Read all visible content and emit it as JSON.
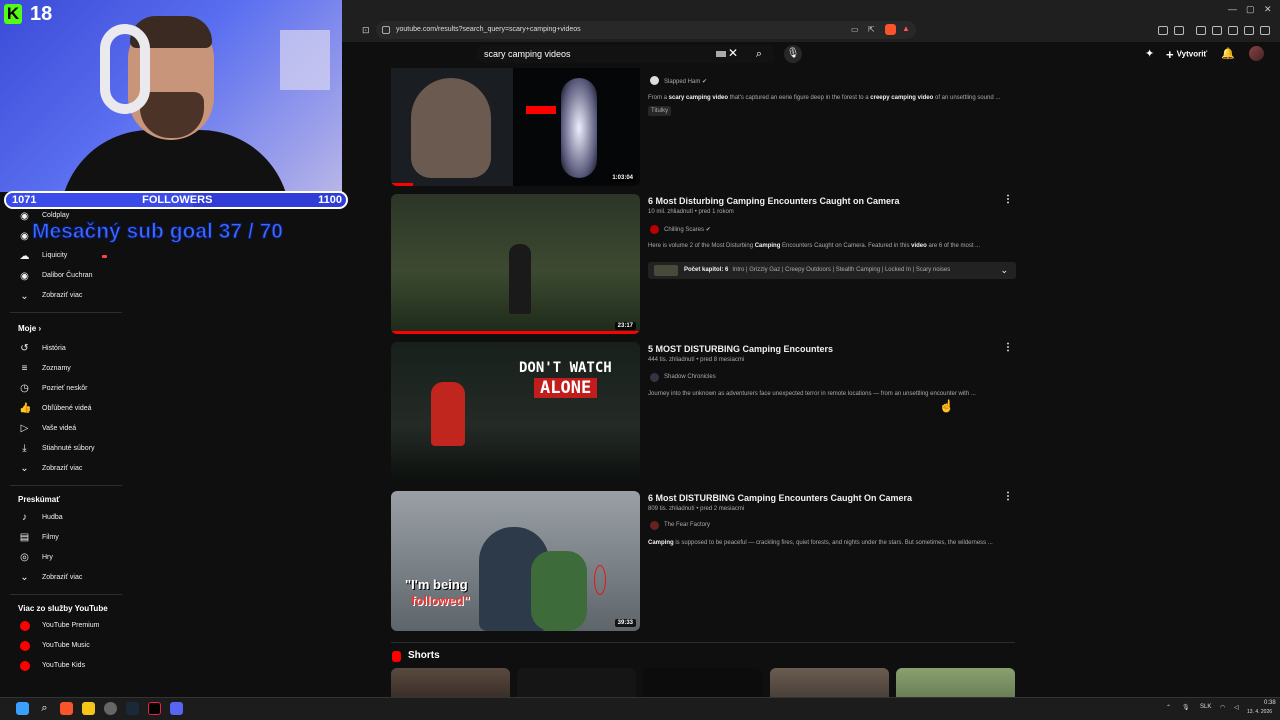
{
  "stream_overlay": {
    "kick_badge": "K",
    "viewer_count": "18",
    "followers_current": "1071",
    "followers_label": "FOLLOWERS",
    "followers_goal": "1100",
    "followers_progress_fraction": 0.55,
    "sub_goal_text": "Mesačný sub goal 37 / 70"
  },
  "browser": {
    "url": "youtube.com/results?search_query=scary+camping+videos"
  },
  "youtube_header": {
    "search_query": "scary camping videos",
    "create_label": "Vytvoriť"
  },
  "sidebar": {
    "subscriptions": [
      {
        "label": "Coldplay",
        "icon": "channel-avatar-icon"
      },
      {
        "label": "Liquicity",
        "icon": "channel-avatar-icon"
      },
      {
        "label": "Dalibor Čuchran",
        "icon": "channel-avatar-icon"
      }
    ],
    "show_more_1": "Zobraziť viac",
    "you_heading": "Moje",
    "you_items": [
      {
        "label": "História",
        "icon": "history-icon"
      },
      {
        "label": "Zoznamy",
        "icon": "playlists-icon"
      },
      {
        "label": "Pozrieť neskôr",
        "icon": "watch-later-icon"
      },
      {
        "label": "Obľúbené videá",
        "icon": "liked-icon"
      },
      {
        "label": "Vaše videá",
        "icon": "your-videos-icon"
      },
      {
        "label": "Stiahnuté súbory",
        "icon": "download-icon"
      }
    ],
    "show_more_2": "Zobraziť viac",
    "explore_heading": "Preskúmať",
    "explore_items": [
      {
        "label": "Hudba",
        "icon": "music-icon"
      },
      {
        "label": "Filmy",
        "icon": "movies-icon"
      },
      {
        "label": "Hry",
        "icon": "gaming-icon"
      }
    ],
    "show_more_3": "Zobraziť viac",
    "more_heading": "Viac zo služby YouTube",
    "more_items": [
      {
        "label": "YouTube Premium"
      },
      {
        "label": "YouTube Music"
      },
      {
        "label": "YouTube Kids"
      }
    ]
  },
  "results": [
    {
      "channel": "Slapped Ham",
      "desc_pre": "From a ",
      "desc_b1": "scary camping video",
      "desc_mid": " that's captured an eerie figure deep in the forest to a ",
      "desc_b2": "creepy camping video",
      "desc_post": " of an unsettling sound ...",
      "badge": "Titulky",
      "duration": "1:03:04"
    },
    {
      "title": "6 Most Disturbing Camping Encounters Caught on Camera",
      "meta": "10 mil. zhliadnutí • pred 1 rokom",
      "channel": "Chilling Scares",
      "desc_pre": "Here is volume 2 of the Most Disturbing ",
      "desc_b1": "Camping",
      "desc_mid": " Encounters Caught on Camera. Featured in this ",
      "desc_b2": "video",
      "desc_post": " are 6 of the most ...",
      "chapters_label": "Počet kapitol: 6",
      "chapters_text": "Intro | Grizzly Gaz | Creepy Outdoors | Stealth Camping | Locked In | Scary noises",
      "duration": "23:17"
    },
    {
      "title": "5 MOST DISTURBING Camping Encounters",
      "meta": "444 tis. zhliadnutí • pred 8 mesiacmi",
      "channel": "Shadow Chronicles",
      "desc": "Journey into the unknown as adventurers face unexpected terror in remote locations — from an unsettling encounter with ...",
      "thumb_text_1": "DON'T WATCH",
      "thumb_text_2": "ALONE"
    },
    {
      "title": "6 Most DISTURBING Camping Encounters Caught On Camera",
      "meta": "809 tis. zhliadnutí • pred 2 mesiacmi",
      "channel": "The Fear Factory",
      "desc_b1": "Camping",
      "desc_post": " is supposed to be peaceful — crackling fires, quiet forests, and nights under the stars. But sometimes, the wilderness ...",
      "thumb_text_1": "\"I'm being",
      "thumb_text_2": "followed\"",
      "duration": "39:33"
    }
  ],
  "shorts_heading": "Shorts",
  "taskbar": {
    "lang": "SLK",
    "time": "0:38",
    "date": "13. 4. 2026"
  },
  "colors": {
    "accent_red": "#ff0000",
    "overlay_blue": "#2f3dd6",
    "kick_green": "#53fc18"
  }
}
